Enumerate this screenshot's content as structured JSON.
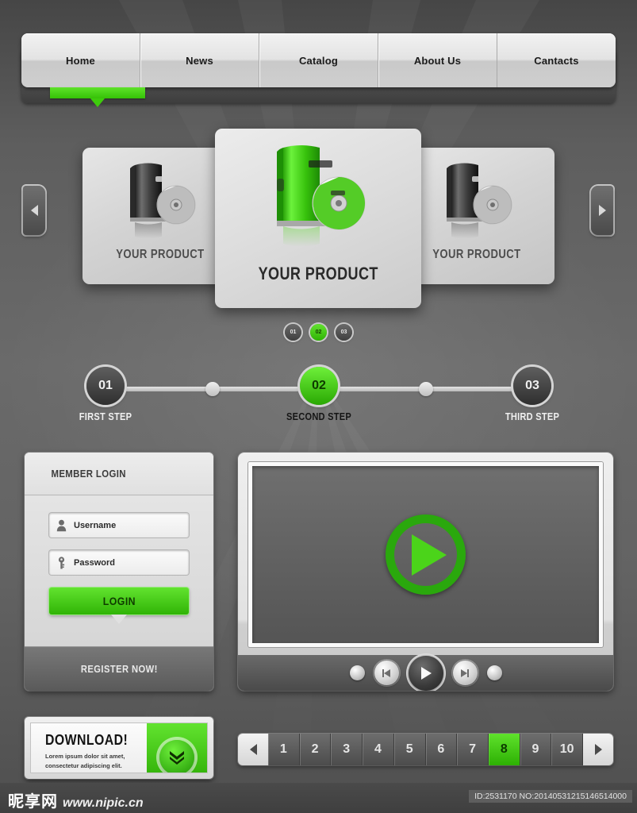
{
  "theme": {
    "accent_green": "#3ecb0c",
    "accent_green_dark": "#2aa80d",
    "bg_gray": "#5e5e5e",
    "panel_light": "#e8e8e8"
  },
  "nav": {
    "items": [
      {
        "label": "Home",
        "active": true
      },
      {
        "label": "News",
        "active": false
      },
      {
        "label": "Catalog",
        "active": false
      },
      {
        "label": "About Us",
        "active": false
      },
      {
        "label": "Cantacts",
        "active": false
      }
    ]
  },
  "carousel": {
    "prev_label": "previous-slide",
    "next_label": "next-slide",
    "slides": [
      {
        "caption": "YOUR PRODUCT",
        "active": false
      },
      {
        "caption": "YOUR PRODUCT",
        "active": true
      },
      {
        "caption": "YOUR PRODUCT",
        "active": false
      }
    ],
    "dots": [
      {
        "label": "01",
        "active": false
      },
      {
        "label": "02",
        "active": true
      },
      {
        "label": "03",
        "active": false
      }
    ]
  },
  "steps": [
    {
      "number": "01",
      "label": "FIRST STEP",
      "active": false
    },
    {
      "number": "02",
      "label": "SECOND STEP",
      "active": true
    },
    {
      "number": "03",
      "label": "THIRD STEP",
      "active": false
    }
  ],
  "login": {
    "title": "MEMBER LOGIN",
    "username": {
      "value": "Username",
      "icon": "user-icon"
    },
    "password": {
      "value": "Password",
      "icon": "key-icon"
    },
    "submit_label": "LOGIN",
    "register_label": "REGISTER NOW!"
  },
  "video": {
    "play_label": "play-video",
    "controls": [
      {
        "name": "volume-dot-left",
        "kind": "dot"
      },
      {
        "name": "rewind-button",
        "kind": "rewind"
      },
      {
        "name": "play-button",
        "kind": "play"
      },
      {
        "name": "forward-button",
        "kind": "forward"
      },
      {
        "name": "volume-dot-right",
        "kind": "dot"
      }
    ]
  },
  "download": {
    "title": "DOWNLOAD!",
    "subtitle": "Lorem ipsum dolor sit amet, consectetur adipiscing elit.",
    "badge_icon": "double-chevron-down-icon"
  },
  "pagination": {
    "prev_label": "previous-page",
    "next_label": "next-page",
    "pages": [
      "1",
      "2",
      "3",
      "4",
      "5",
      "6",
      "7",
      "8",
      "9",
      "10"
    ],
    "current": "8"
  },
  "footer": {
    "brand_cn": "昵享网",
    "brand_url": "www.nipic.cn",
    "id_text": "ID:2531170 NO:20140531215146514000"
  }
}
